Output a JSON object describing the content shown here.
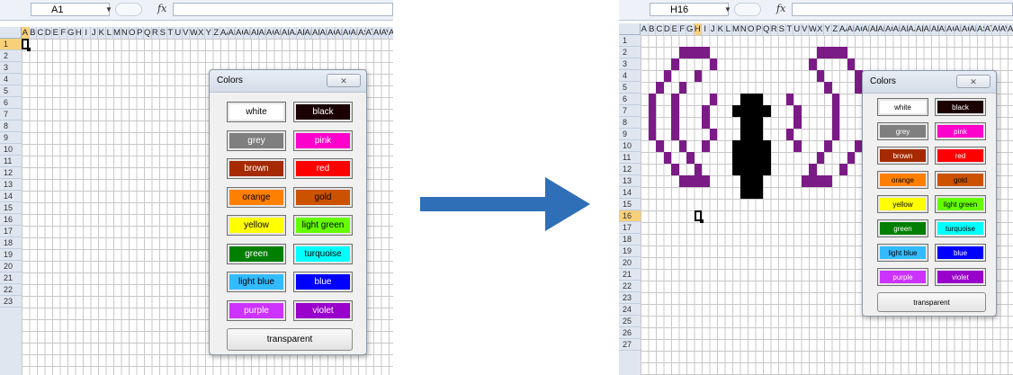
{
  "columns": [
    "A",
    "B",
    "C",
    "D",
    "E",
    "F",
    "G",
    "H",
    "I",
    "J",
    "K",
    "L",
    "M",
    "N",
    "O",
    "P",
    "Q",
    "R",
    "S",
    "T",
    "U",
    "V",
    "W",
    "X",
    "Y",
    "Z",
    "AA",
    "AB",
    "AC",
    "AD",
    "AE",
    "AF",
    "AG",
    "AH",
    "AI",
    "AJ",
    "AK",
    "AL",
    "AM",
    "AN",
    "AO",
    "AP",
    "AQ",
    "AR",
    "AS",
    "AT",
    "AU",
    "AV",
    "AW",
    "AX"
  ],
  "left": {
    "name_box": "A1",
    "fx_label": "fx",
    "rows": [
      "1",
      "2",
      "3",
      "4",
      "5",
      "6",
      "7",
      "8",
      "9",
      "10",
      "11",
      "12",
      "13",
      "14",
      "15",
      "16",
      "17",
      "18",
      "19",
      "20",
      "21",
      "22",
      "23"
    ],
    "active_col": "A",
    "active_row": "1",
    "dialog": {
      "title": "Colors",
      "close_label": "✕",
      "buttons": [
        {
          "label": "white",
          "bg": "#ffffff",
          "fg": "#000000"
        },
        {
          "label": "black",
          "bg": "#1a0000",
          "fg": "#ffffff"
        },
        {
          "label": "grey",
          "bg": "#7f7f7f",
          "fg": "#ffffff"
        },
        {
          "label": "pink",
          "bg": "#ff00cc",
          "fg": "#ffffff"
        },
        {
          "label": "brown",
          "bg": "#a52a00",
          "fg": "#ffffff"
        },
        {
          "label": "red",
          "bg": "#ff0000",
          "fg": "#ffffff"
        },
        {
          "label": "orange",
          "bg": "#ff7f00",
          "fg": "#000000"
        },
        {
          "label": "gold",
          "bg": "#cc5200",
          "fg": "#000000"
        },
        {
          "label": "yellow",
          "bg": "#ffff00",
          "fg": "#000000"
        },
        {
          "label": "light green",
          "bg": "#66ff00",
          "fg": "#000000"
        },
        {
          "label": "green",
          "bg": "#007f00",
          "fg": "#ffffff"
        },
        {
          "label": "turquoise",
          "bg": "#00ffff",
          "fg": "#000000"
        },
        {
          "label": "light blue",
          "bg": "#33bbff",
          "fg": "#000000"
        },
        {
          "label": "blue",
          "bg": "#0000ff",
          "fg": "#ffffff"
        },
        {
          "label": "purple",
          "bg": "#cc33ff",
          "fg": "#ffffff"
        },
        {
          "label": "violet",
          "bg": "#9900cc",
          "fg": "#ffffff"
        }
      ],
      "transparent_label": "transparent"
    }
  },
  "right": {
    "name_box": "H16",
    "fx_label": "fx",
    "rows": [
      "1",
      "2",
      "3",
      "4",
      "5",
      "6",
      "7",
      "8",
      "9",
      "10",
      "11",
      "12",
      "13",
      "14",
      "15",
      "16",
      "17",
      "18",
      "19",
      "20",
      "21",
      "22",
      "23",
      "24",
      "25",
      "26",
      "27"
    ],
    "active_col": "H",
    "active_row": "16",
    "pixel_art": {
      "purple": "#7b1b86",
      "black": "#000000",
      "rows": [
        ".......................................",
        ".....PPPP..............PPPP............",
        "....P....P............P....P...........",
        "...P...P...............P....P..........",
        "..P..P..................P...P..........",
        ".P..P....P...BBB...P.....P...P.........",
        ".P..P...P...BBBBB...P....P...P.........",
        ".P..P...P....BBB....P....P...P.........",
        ".P..P....P...BBB...P.....P...P.........",
        "..P..P..P...BBBBB...P...P...P..........",
        "...P..P.....BBBBB......P...P...........",
        "....P..P....BBBBB.....P...P............",
        ".....PPPP....BBB.....PPPP..............",
        ".............BBB.......................",
        ".......................................",
        ".......................................",
        ".......................................",
        ".......................................",
        ".......................................",
        ".......................................",
        ".......................................",
        ".......................................",
        ".......................................",
        ".......................................",
        ".......................................",
        ".......................................",
        "......................................."
      ]
    },
    "dialog": {
      "title": "Colors",
      "close_label": "✕",
      "buttons": [
        {
          "label": "white",
          "bg": "#ffffff",
          "fg": "#000000"
        },
        {
          "label": "black",
          "bg": "#1a0000",
          "fg": "#ffffff"
        },
        {
          "label": "grey",
          "bg": "#7f7f7f",
          "fg": "#ffffff"
        },
        {
          "label": "pink",
          "bg": "#ff00cc",
          "fg": "#ffffff"
        },
        {
          "label": "brown",
          "bg": "#a52a00",
          "fg": "#ffffff"
        },
        {
          "label": "red",
          "bg": "#ff0000",
          "fg": "#ffffff"
        },
        {
          "label": "orange",
          "bg": "#ff7f00",
          "fg": "#000000"
        },
        {
          "label": "gold",
          "bg": "#cc5200",
          "fg": "#000000"
        },
        {
          "label": "yellow",
          "bg": "#ffff00",
          "fg": "#000000"
        },
        {
          "label": "light green",
          "bg": "#66ff00",
          "fg": "#000000"
        },
        {
          "label": "green",
          "bg": "#007f00",
          "fg": "#ffffff"
        },
        {
          "label": "turquoise",
          "bg": "#00ffff",
          "fg": "#000000"
        },
        {
          "label": "light blue",
          "bg": "#33bbff",
          "fg": "#000000"
        },
        {
          "label": "blue",
          "bg": "#0000ff",
          "fg": "#ffffff"
        },
        {
          "label": "purple",
          "bg": "#cc33ff",
          "fg": "#ffffff"
        },
        {
          "label": "violet",
          "bg": "#9900cc",
          "fg": "#ffffff"
        }
      ],
      "transparent_label": "transparent"
    }
  },
  "arrow": {
    "color": "#2f6fb7",
    "direction": "right"
  }
}
